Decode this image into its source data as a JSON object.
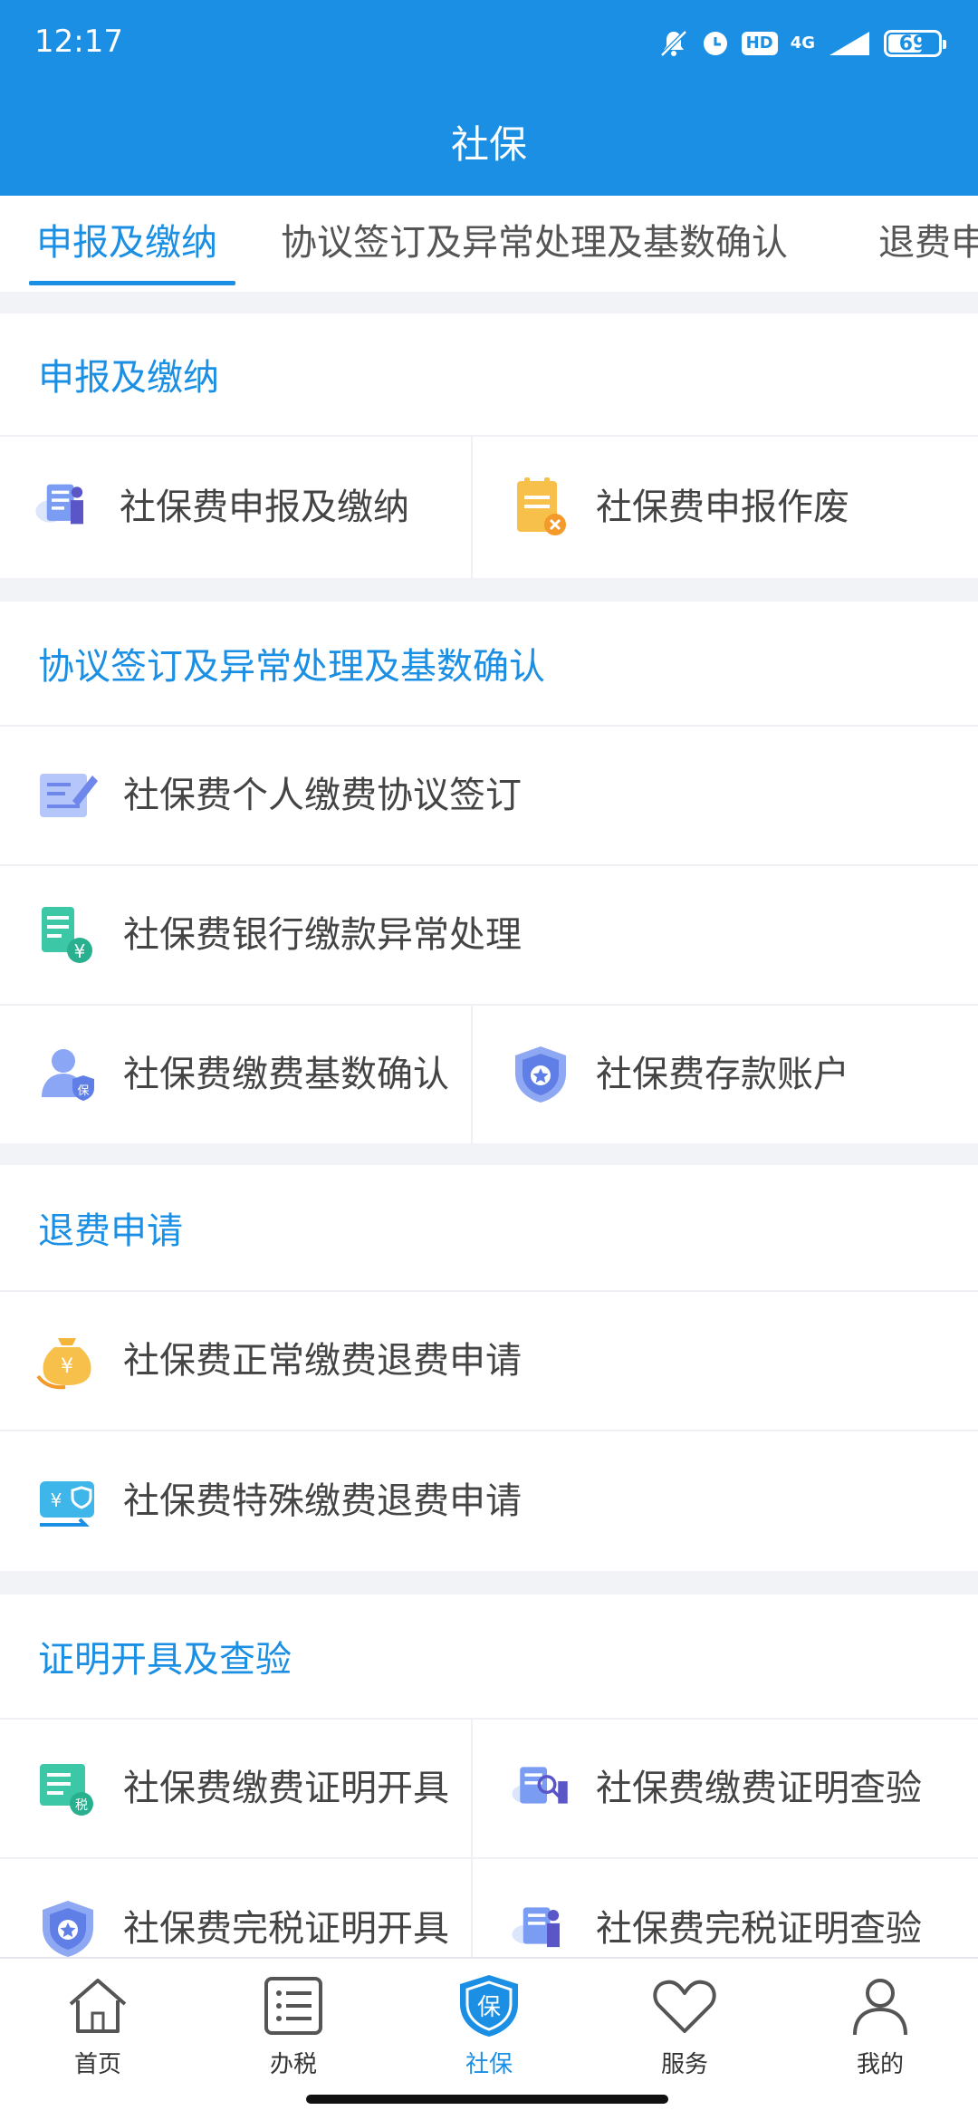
{
  "status_bar": {
    "time": "12:17",
    "hd": "HD",
    "network": "4G",
    "battery": "69",
    "battery_level": 0.69
  },
  "header": {
    "title": "社保"
  },
  "tabs": [
    {
      "label": "申报及缴纳",
      "active": true
    },
    {
      "label": "协议签订及异常处理及基数确认",
      "active": false
    },
    {
      "label": "退费申请",
      "active": false
    }
  ],
  "sections": {
    "declare": {
      "title": "申报及缴纳",
      "items": [
        "社保费申报及缴纳",
        "社保费申报作废"
      ]
    },
    "agreement": {
      "title": "协议签订及异常处理及基数确认",
      "items": [
        "社保费个人缴费协议签订",
        "社保费银行缴款异常处理",
        "社保费缴费基数确认",
        "社保费存款账户"
      ]
    },
    "refund": {
      "title": "退费申请",
      "items": [
        "社保费正常缴费退费申请",
        "社保费特殊缴费退费申请"
      ]
    },
    "certificate": {
      "title": "证明开具及查验",
      "items": [
        "社保费缴费证明开具",
        "社保费缴费证明查验",
        "社保费完税证明开具",
        "社保费完税证明查验"
      ]
    }
  },
  "bottom_nav": [
    {
      "label": "首页",
      "icon": "home-icon"
    },
    {
      "label": "办税",
      "icon": "list-icon"
    },
    {
      "label": "社保",
      "icon": "shield-bao-icon",
      "active": true,
      "badge": "保"
    },
    {
      "label": "服务",
      "icon": "heart-icon"
    },
    {
      "label": "我的",
      "icon": "user-icon"
    }
  ],
  "colors": {
    "primary": "#1a8fe3",
    "background": "#f2f3f7"
  }
}
